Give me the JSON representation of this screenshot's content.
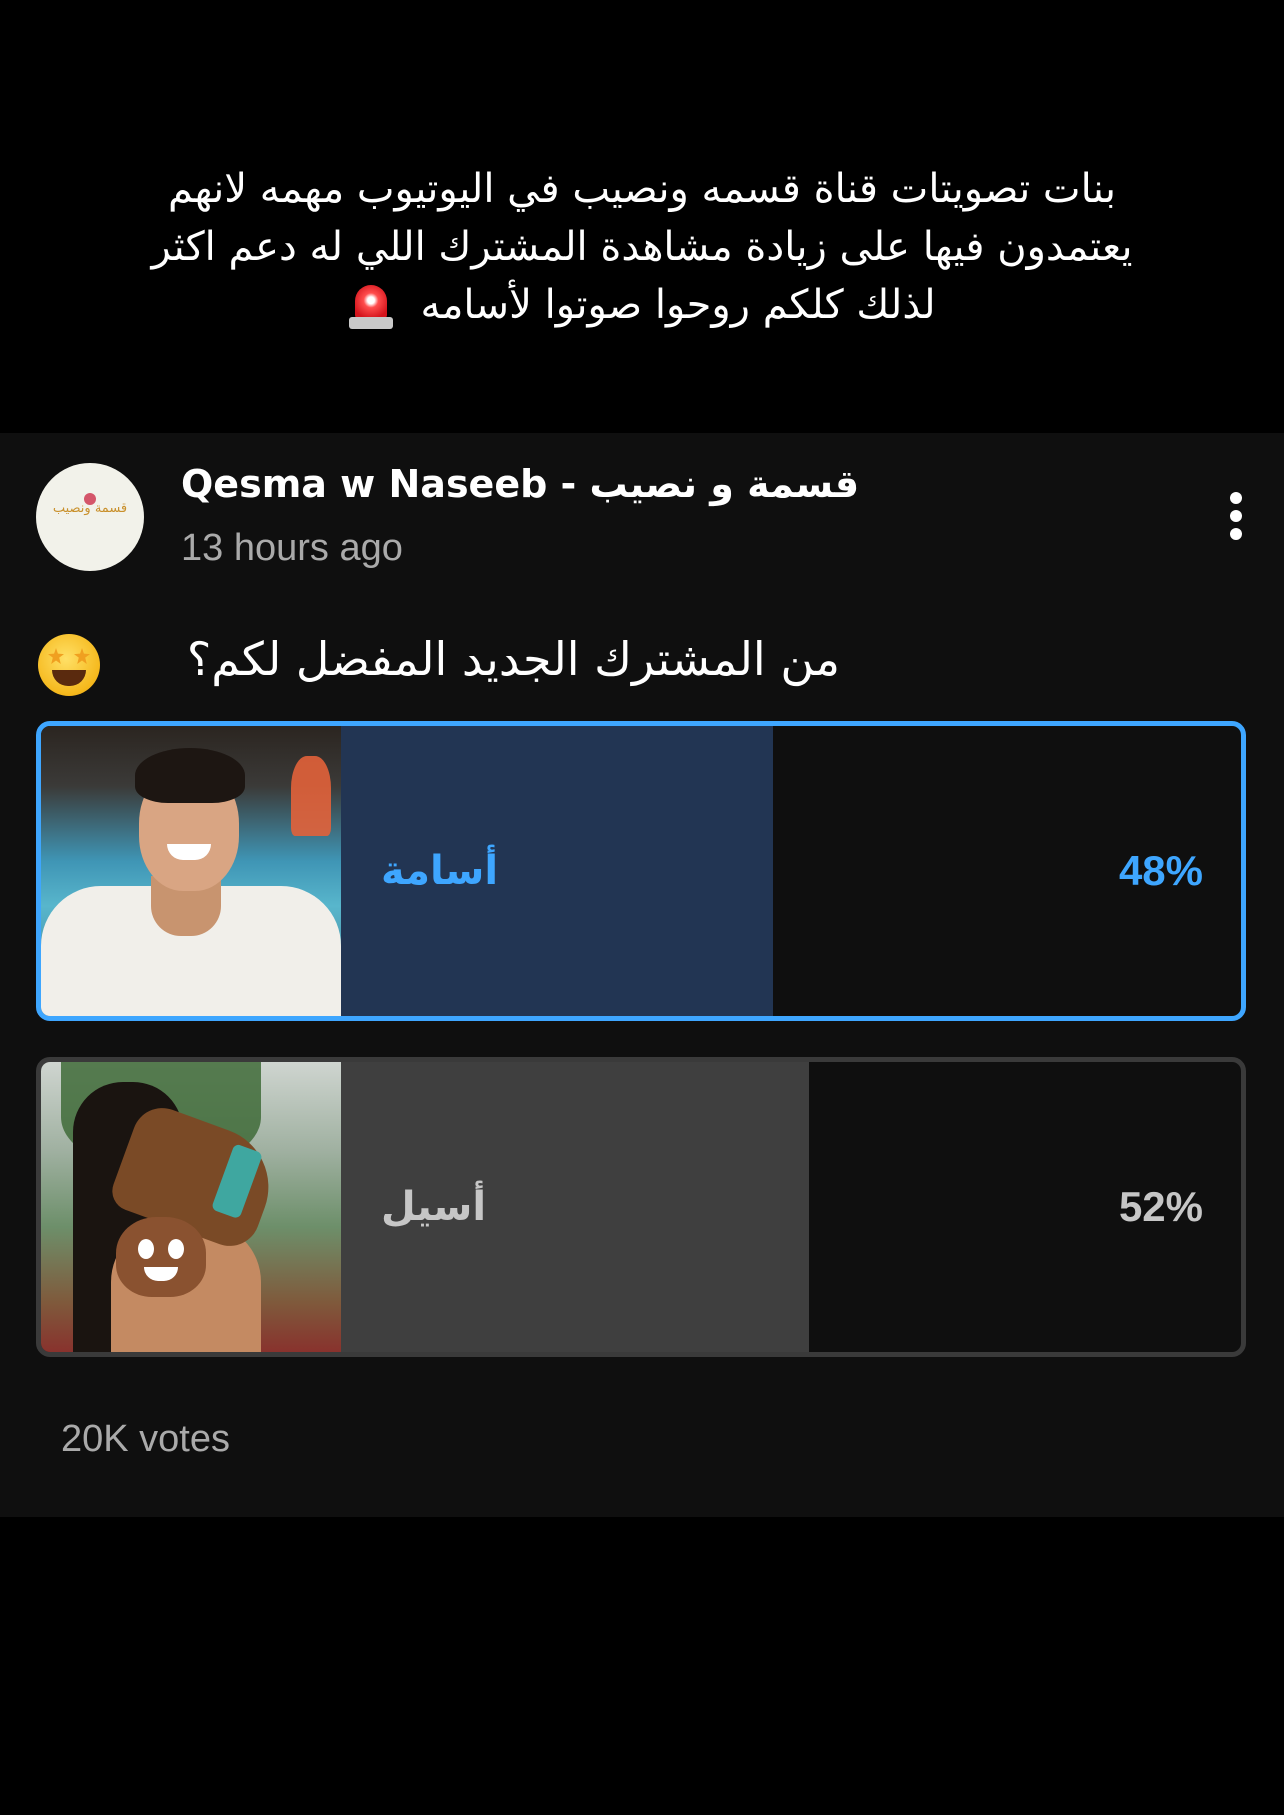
{
  "caption": {
    "line1": "بنات تصويتات قناة قسمه ونصيب في اليوتيوب مهمه لانهم",
    "line2": "يعتمدون فيها على زيادة مشاهدة المشترك اللي له دعم اكثر",
    "line3": "لذلك كلكم روحوا صوتوا لأسامه",
    "emoji": "rotating-light-icon"
  },
  "post": {
    "channel_name": "Qesma w Naseeb - قسمة و نصيب",
    "timestamp": "13 hours ago",
    "avatar_text": "قسمة ونصيب",
    "question": "من المشترك الجديد المفضل لكم؟",
    "question_emoji": "star-struck-face-icon"
  },
  "poll": {
    "options": [
      {
        "label": "أسامة",
        "percent_text": "48%",
        "percent": 48,
        "selected": true,
        "thumb_icon": "contestant-photo"
      },
      {
        "label": "أسيل",
        "percent_text": "52%",
        "percent": 52,
        "selected": false,
        "thumb_icon": "contestant-photo-with-boot-and-poop-emoji"
      }
    ],
    "votes": "20K votes"
  },
  "colors": {
    "accent": "#3ea6ff",
    "selected_fill": "#223553",
    "unselected_fill": "#3f3f3f",
    "card_bg": "#0f0f0f",
    "secondary_text": "#aaaaaa"
  }
}
